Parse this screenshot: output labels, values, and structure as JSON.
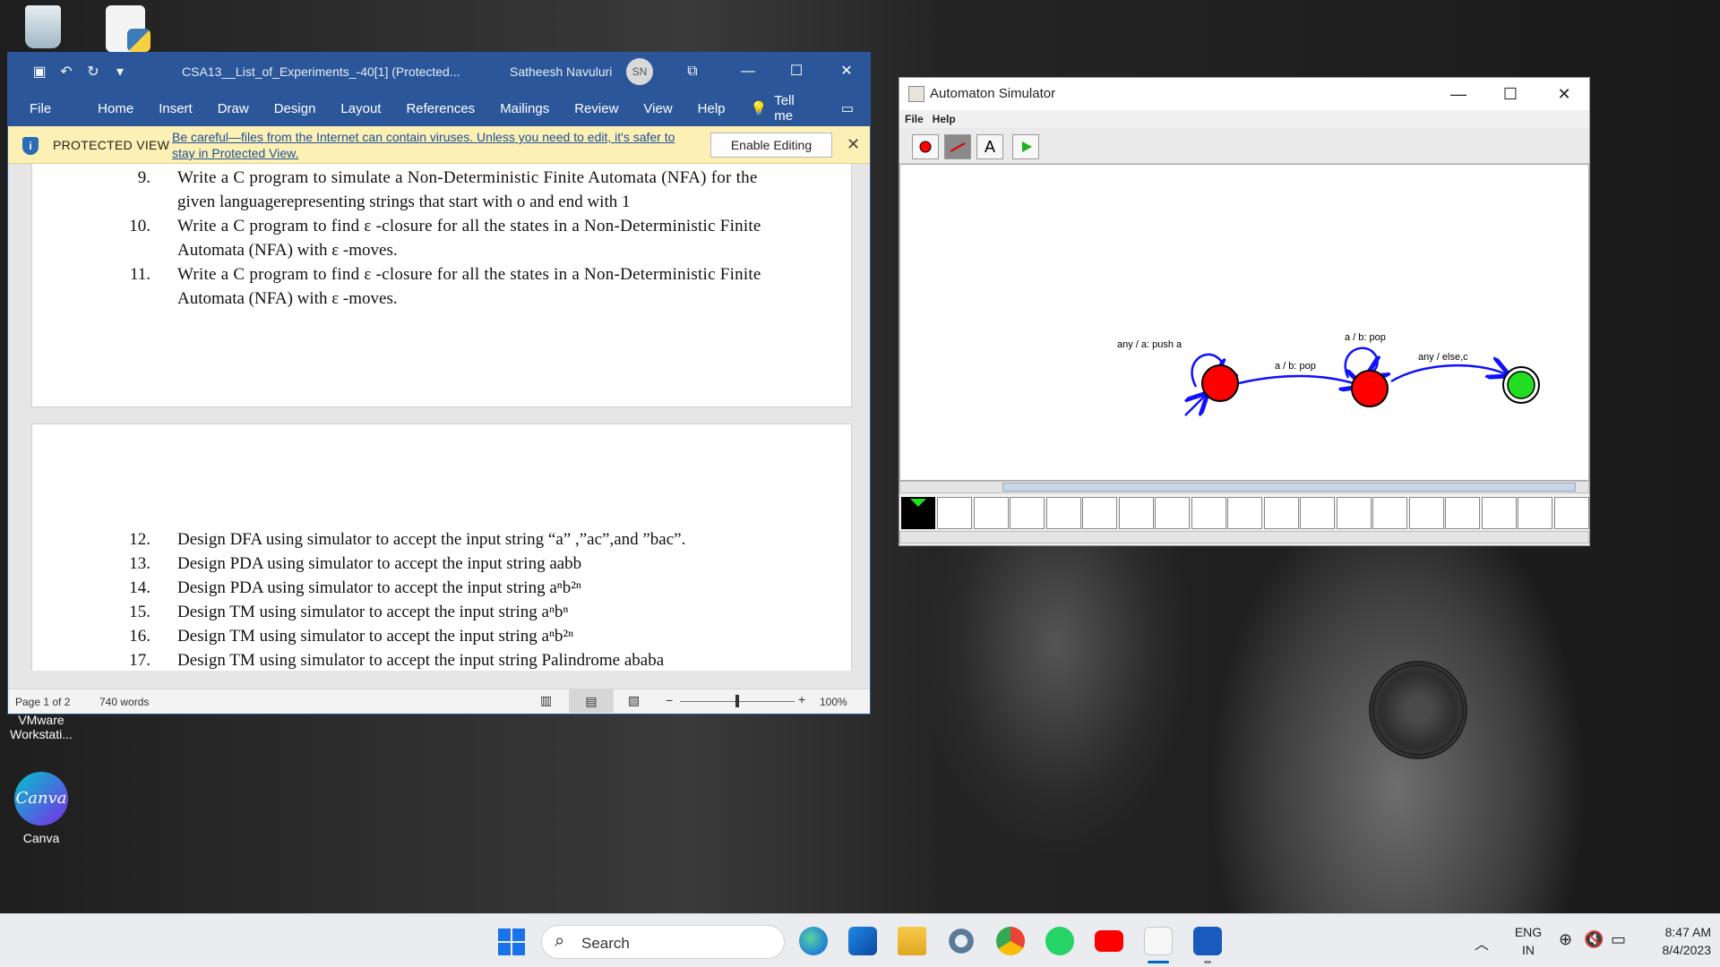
{
  "desktop": {
    "icons": [
      {
        "label": ""
      },
      {
        "label": ""
      },
      {
        "label": "VMware Workstati..."
      },
      {
        "label": "Canva"
      }
    ],
    "canva_logo_text": "Canva"
  },
  "word": {
    "title": "CSA13__List_of_Experiments_-40[1] (Protected...",
    "user": "Satheesh Navuluri",
    "avatar": "SN",
    "tabs": [
      "File",
      "Home",
      "Insert",
      "Draw",
      "Design",
      "Layout",
      "References",
      "Mailings",
      "Review",
      "View",
      "Help",
      "Tell me"
    ],
    "protected_view": {
      "label": "PROTECTED VIEW",
      "message": "Be careful—files from the Internet can contain viruses. Unless you need to edit, it's safer to stay in Protected View.",
      "button": "Enable Editing"
    },
    "page1_lines": [
      {
        "num": "9.",
        "text": "Write a C program to simulate a Non-Deterministic Finite Automata (NFA) for the"
      },
      {
        "num": "",
        "text": "given languagerepresenting strings that start with o and end with 1"
      },
      {
        "num": "10.",
        "text": "Write a C program to find ε -closure for all the states in a Non-Deterministic Finite"
      },
      {
        "num": "",
        "text": "Automata (NFA) with ε -moves."
      },
      {
        "num": "11.",
        "text": "Write a C program to find ε -closure for all the states in a Non-Deterministic Finite"
      },
      {
        "num": "",
        "text": "Automata (NFA) with ε -moves."
      }
    ],
    "page2_lines": [
      {
        "num": "12.",
        "text": "Design DFA  using simulator to accept the input string “a” ,”ac”,and ”bac”."
      },
      {
        "num": "13.",
        "text": "Design PDA using simulator to accept the input string aabb"
      },
      {
        "num": "14.",
        "text": "Design PDA using simulator to accept the input string  aⁿb²ⁿ"
      },
      {
        "num": "15.",
        "text": "Design TM using simulator to accept the input string aⁿbⁿ"
      },
      {
        "num": "16.",
        "text": "Design TM using simulator to accept the input string aⁿb²ⁿ"
      },
      {
        "num": "17.",
        "text": "Design TM using simulator to accept the input string Palindrome  ababa"
      }
    ],
    "status": {
      "page": "Page 1 of 2",
      "words": "740 words",
      "zoom": "100%"
    }
  },
  "simulator": {
    "title": "Automaton Simulator",
    "menu": [
      "File",
      "Help"
    ],
    "edge_labels": {
      "loop1": "any / a: push a",
      "edge12": "a / b: pop",
      "loop2": "a / b: pop",
      "edge23": "any / else,c"
    },
    "colors": {
      "state": "#ff0000",
      "accept": "#22dd22",
      "edge": "#1010ff"
    }
  },
  "taskbar": {
    "search": "Search",
    "lang_line1": "ENG",
    "lang_line2": "IN",
    "time": "8:47 AM",
    "date": "8/4/2023"
  }
}
